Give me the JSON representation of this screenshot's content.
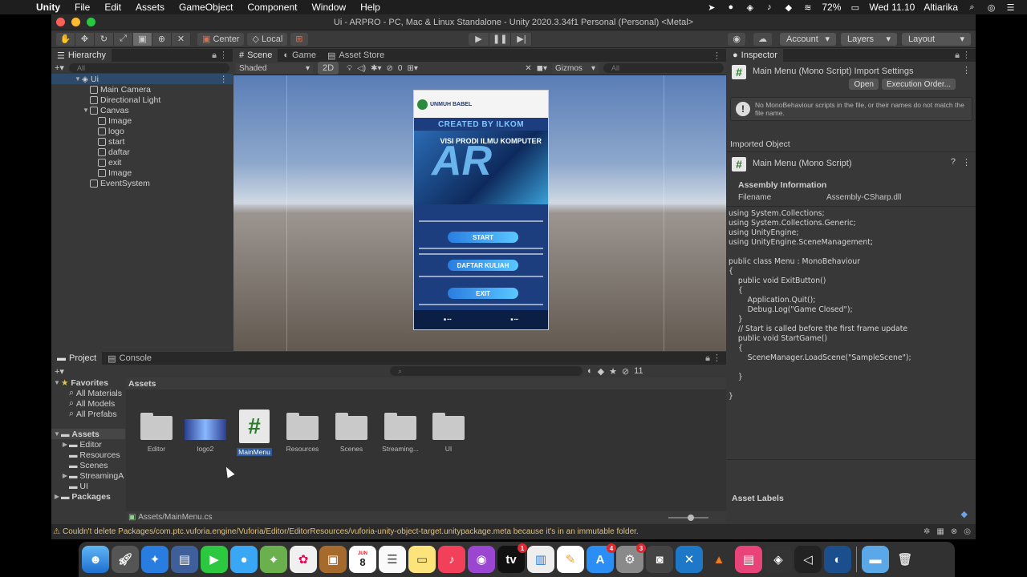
{
  "menubar": {
    "app_name": "Unity",
    "items": [
      "File",
      "Edit",
      "Assets",
      "GameObject",
      "Component",
      "Window",
      "Help"
    ],
    "battery": "72%",
    "clock": "Wed 11.10",
    "user": "Altiarika"
  },
  "window": {
    "title": "Ui - ARPRO - PC, Mac & Linux Standalone - Unity 2020.3.34f1 Personal (Personal) <Metal>"
  },
  "toolbar": {
    "pivot_label": "Center",
    "space_label": "Local",
    "account_label": "Account",
    "layers_label": "Layers",
    "layout_label": "Layout"
  },
  "hierarchy": {
    "tab_label": "Hierarchy",
    "search_placeholder": "All",
    "scene_name": "Ui",
    "items": [
      {
        "label": "Main Camera",
        "depth": 1
      },
      {
        "label": "Directional Light",
        "depth": 1
      },
      {
        "label": "Canvas",
        "depth": 1
      },
      {
        "label": "Image",
        "depth": 2
      },
      {
        "label": "logo",
        "depth": 2
      },
      {
        "label": "start",
        "depth": 2
      },
      {
        "label": "daftar",
        "depth": 2
      },
      {
        "label": "exit",
        "depth": 2
      },
      {
        "label": "Image",
        "depth": 2
      },
      {
        "label": "EventSystem",
        "depth": 1
      }
    ]
  },
  "scene": {
    "tabs": [
      "Scene",
      "Game",
      "Asset Store"
    ],
    "shading_mode": "Shaded",
    "mode_2d": "2D",
    "hidden_count": "0",
    "gizmos_label": "Gizmos",
    "search_placeholder": "All",
    "poster": {
      "brand": "UNMUH BABEL",
      "created_by": "CREATED BY ILKOM",
      "visi_text": "VISI PRODI ILMU KOMPUTER",
      "start_button": "START",
      "daftar_button": "DAFTAR KULIAH",
      "exit_button": "EXIT"
    }
  },
  "inspector": {
    "tab_label": "Inspector",
    "title": "Main Menu (Mono Script) Import Settings",
    "open_button": "Open",
    "execution_order_button": "Execution Order...",
    "warning": "No MonoBehaviour scripts in the file, or their names do not match the file name.",
    "imported_object_label": "Imported Object",
    "script_name": "Main Menu (Mono Script)",
    "assembly_info_label": "Assembly Information",
    "filename_label": "Filename",
    "filename_value": "Assembly-CSharp.dll",
    "code": "using System.Collections;\nusing System.Collections.Generic;\nusing UnityEngine;\nusing UnityEngine.SceneManagement;\n\npublic class Menu : MonoBehaviour\n{\n    public void ExitButton()\n    {\n        Application.Quit();\n        Debug.Log(\"Game Closed\");\n    }\n    // Start is called before the first frame update\n    public void StartGame()\n    {\n        SceneManager.LoadScene(\"SampleScene\");\n\n    }\n\n}",
    "asset_labels": "Asset Labels"
  },
  "project": {
    "tabs": [
      "Project",
      "Console"
    ],
    "hidden_count": "11",
    "favorites_label": "Favorites",
    "favorites": [
      "All Materials",
      "All Models",
      "All Prefabs"
    ],
    "assets_label": "Assets",
    "asset_tree": [
      "Editor",
      "Resources",
      "Scenes",
      "StreamingA",
      "UI"
    ],
    "packages_label": "Packages",
    "main_header": "Assets",
    "assets": [
      {
        "name": "Editor",
        "kind": "folder"
      },
      {
        "name": "logo2",
        "kind": "image"
      },
      {
        "name": "MainMenu",
        "kind": "script"
      },
      {
        "name": "Resources",
        "kind": "folder"
      },
      {
        "name": "Scenes",
        "kind": "folder"
      },
      {
        "name": "Streaming...",
        "kind": "folder"
      },
      {
        "name": "UI",
        "kind": "folder"
      }
    ],
    "selected_path": "Assets/MainMenu.cs"
  },
  "status": {
    "message": "Couldn't delete Packages/com.ptc.vuforia.engine/Vuforia/Editor/EditorResources/vuforia-unity-object-target.unitypackage.meta because it's in an immutable folder."
  },
  "dock": {
    "calendar_day": "8",
    "badges": {
      "tv": "1",
      "appstore": "4",
      "settings": "3"
    }
  },
  "colors": {
    "accent_selection": "#2e4a6a",
    "warning_text": "#e2c07a",
    "script_icon_green": "#2a7a2a"
  }
}
